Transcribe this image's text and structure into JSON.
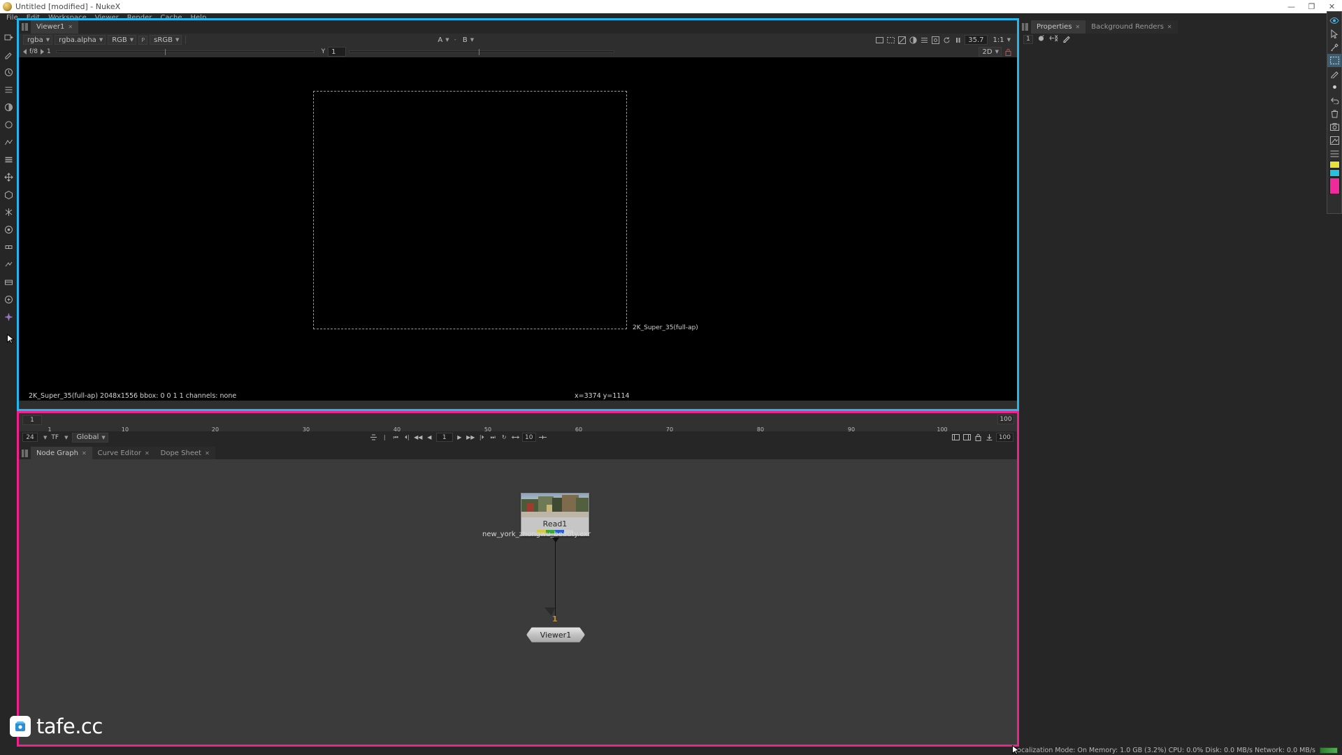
{
  "window": {
    "title": "Untitled [modified] - NukeX",
    "app_icon": "nuke-logo-icon",
    "controls": {
      "minimize": "—",
      "maximize": "❐",
      "close": "✕"
    }
  },
  "menubar": {
    "items": [
      "File",
      "Edit",
      "Workspace",
      "Viewer",
      "Render",
      "Cache",
      "Help"
    ]
  },
  "left_toolbar": {
    "items": [
      {
        "name": "image-nodes-icon"
      },
      {
        "name": "draw-nodes-icon"
      },
      {
        "name": "time-nodes-icon"
      },
      {
        "name": "channel-nodes-icon"
      },
      {
        "name": "color-nodes-icon"
      },
      {
        "name": "filter-nodes-icon"
      },
      {
        "name": "keyer-nodes-icon"
      },
      {
        "name": "merge-nodes-icon"
      },
      {
        "name": "transform-nodes-icon"
      },
      {
        "name": "3d-nodes-icon"
      },
      {
        "name": "particles-nodes-icon"
      },
      {
        "name": "deep-nodes-icon"
      },
      {
        "name": "stereo-nodes-icon"
      },
      {
        "name": "metadata-nodes-icon"
      },
      {
        "name": "toolsets-icon"
      },
      {
        "name": "other-nodes-icon"
      },
      {
        "name": "plugin-nodes-icon"
      }
    ]
  },
  "viewer": {
    "tab_label": "Viewer1",
    "tab_close": "✕",
    "toolbar": {
      "channels": "rgba",
      "layer": "rgba.alpha",
      "display_channel": "RGB",
      "viewer_process": "sRGB",
      "proxy_icon": "proxy-icon",
      "input_a_label": "A",
      "input_a_value": "",
      "input_a_sep": "-",
      "input_b_label": "B",
      "input_b_value": "",
      "zoom_level": "35.7",
      "zoom_ratio": "1:1",
      "gain_label": "f/8",
      "gamma_label": "1",
      "gamma_prefix": "Y",
      "gamma_value": "1",
      "mode_2d": "2D"
    },
    "canvas": {
      "format_label": "2K_Super_35(full-ap)"
    },
    "status": {
      "format_info": "2K_Super_35(full-ap) 2048x1556  bbox: 0 0 1 1 channels: none",
      "coords": "x=3374 y=1114"
    }
  },
  "timeline": {
    "current_frame": "1",
    "range_end": "100",
    "fps": "24",
    "fps_suffix": "TF",
    "sync_mode": "Global",
    "playhead_frame": "1",
    "increment_value": "10",
    "out_value": "100",
    "playback_frame": "1",
    "ticks": [
      1,
      10,
      20,
      30,
      40,
      50,
      60,
      70,
      80,
      90,
      100
    ],
    "transport": [
      {
        "name": "frame-back-to-start-button",
        "glyph": "⏮"
      },
      {
        "name": "previous-keyframe-button",
        "glyph": "⏴|"
      },
      {
        "name": "step-back-button",
        "glyph": "◀◀"
      },
      {
        "name": "play-backward-button",
        "glyph": "◀"
      },
      {
        "name": "play-forward-button",
        "glyph": "▶"
      },
      {
        "name": "step-forward-button",
        "glyph": "▶▶"
      },
      {
        "name": "next-keyframe-button",
        "glyph": "|⏵"
      },
      {
        "name": "frame-forward-to-end-button",
        "glyph": "⏭"
      },
      {
        "name": "loop-mode-button",
        "glyph": "↻"
      }
    ]
  },
  "nodegraph": {
    "tabs": [
      {
        "label": "Node Graph",
        "close": "✕",
        "active": true
      },
      {
        "label": "Curve Editor",
        "close": "✕",
        "active": false
      },
      {
        "label": "Dope Sheet",
        "close": "✕",
        "active": false
      }
    ],
    "nodes": {
      "read": {
        "name": "Read1",
        "file_label": "new_york_zhongwu_beauty.exr",
        "channel_colors": [
          "#d4c840",
          "#3aa33a",
          "#2a5fd0",
          "#cfcfcf"
        ]
      },
      "viewer": {
        "name": "Viewer1",
        "input_number": "1"
      }
    }
  },
  "properties": {
    "tabs": [
      {
        "label": "Properties",
        "close": "✕",
        "active": true
      },
      {
        "label": "Background Renders",
        "close": "✕",
        "active": false
      }
    ],
    "toolbar": {
      "max_panels": "1",
      "icons": [
        "lock-panels-icon",
        "clear-panels-icon",
        "edit-panels-icon"
      ]
    }
  },
  "right_strip": {
    "items": [
      {
        "name": "viewer-visibility-icon",
        "selected": false
      },
      {
        "name": "select-tool-icon",
        "selected": false
      },
      {
        "name": "color-picker-icon",
        "selected": false
      },
      {
        "name": "region-select-icon",
        "selected": true
      },
      {
        "name": "pen-tool-icon",
        "selected": false
      },
      {
        "name": "point-tool-icon",
        "selected": false
      },
      {
        "name": "undo-icon",
        "selected": false
      },
      {
        "name": "delete-icon",
        "selected": false
      },
      {
        "name": "snapshot-icon",
        "selected": false
      },
      {
        "name": "capture-icon",
        "selected": false
      },
      {
        "name": "list-icon",
        "selected": false
      }
    ],
    "swatches": [
      "#e8e03a",
      "#22c2e0",
      "#f02a9a"
    ]
  },
  "statusbar": {
    "text": "Localization Mode: On  Memory: 1.0 GB (3.2%)  CPU: 0.0%  Disk: 0.0 MB/s  Network: 0.0 MB/s",
    "indicator": "network-activity-chip"
  },
  "watermark": {
    "text": "tafe.cc",
    "icon": "tafe-logo-icon"
  },
  "colors": {
    "viewer_highlight": "#24b7ef",
    "nodegraph_highlight": "#f0208c",
    "panel_bg": "#262626",
    "accent_orange": "#d89a2a"
  }
}
